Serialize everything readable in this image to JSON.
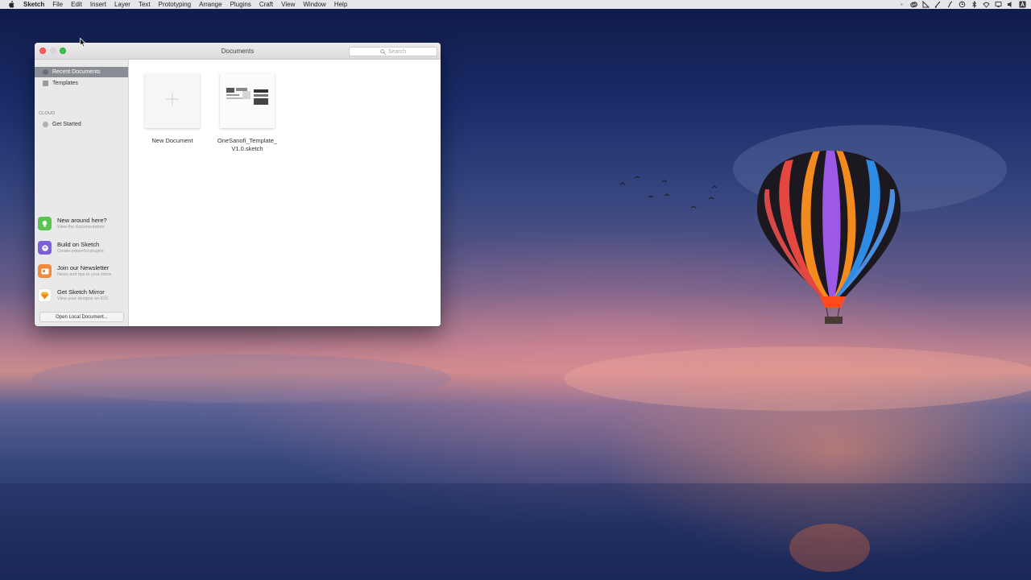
{
  "menubar": {
    "app_name": "Sketch",
    "items": [
      "File",
      "Edit",
      "Insert",
      "Layer",
      "Text",
      "Prototyping",
      "Arrange",
      "Plugins",
      "Craft",
      "View",
      "Window",
      "Help"
    ]
  },
  "window": {
    "title": "Documents",
    "search_placeholder": "Search",
    "sidebar": {
      "items": [
        {
          "label": "Recent Documents",
          "selected": true
        },
        {
          "label": "Templates",
          "selected": false
        }
      ],
      "cloud_section": "CLOUD",
      "cloud_items": [
        {
          "label": "Get Started"
        }
      ],
      "promos": [
        {
          "title": "New around here?",
          "subtitle": "View the documentation",
          "icon": "lightbulb-icon",
          "color": "#5bc44f"
        },
        {
          "title": "Build on Sketch",
          "subtitle": "Create powerful plugins",
          "icon": "plug-icon",
          "color": "#7b61d8"
        },
        {
          "title": "Join our Newsletter",
          "subtitle": "News and tips in your inbox",
          "icon": "mail-icon",
          "color": "#f08a3c"
        },
        {
          "title": "Get Sketch Mirror",
          "subtitle": "View your designs on iOS",
          "icon": "sketch-diamond-icon",
          "color": "#f5b530"
        }
      ],
      "open_local_label": "Open Local Document..."
    },
    "documents": [
      {
        "label": "New Document",
        "type": "new"
      },
      {
        "label_line1": "OneSanofi_Template_",
        "label_line2": "V1.0.sketch",
        "type": "file"
      }
    ]
  },
  "colors": {
    "selection": "#8a8d93",
    "close": "#fc605c",
    "maximize": "#34c84a"
  }
}
